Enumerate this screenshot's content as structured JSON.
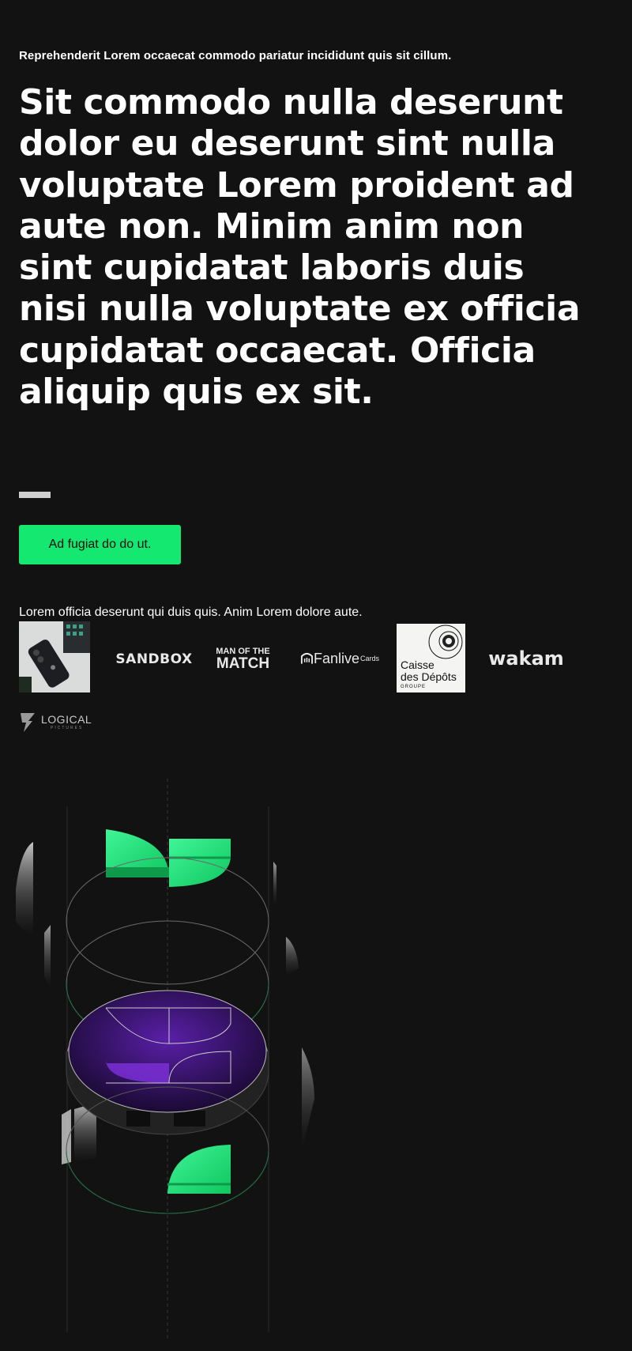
{
  "hero": {
    "eyebrow": "Reprehenderit Lorem occaecat commodo pariatur incididunt quis sit cillum.",
    "headline": "Sit commodo nulla deserunt dolor eu deserunt sint nulla voluptate Lorem proident ad aute non. Minim anim non sint cupidatat laboris duis nisi nulla voluptate ex officia cupidatat occaecat. Officia aliquip quis ex sit.",
    "cta_label": "Ad fugiat do do ut."
  },
  "partners": {
    "label": "Lorem officia deserunt qui duis quis. Anim Lorem dolore aute.",
    "logos": {
      "sandbox": "SANDBOX",
      "motm_top": "MAN OF THE",
      "motm_bottom": "MATCH",
      "fanlive": "Fanlive",
      "fanlive_suffix": "Cards",
      "caisse_line1": "Caisse",
      "caisse_line2": "des Dépôts",
      "caisse_line3": "GROUPE",
      "wakam": "wakam",
      "logical_top": "LOGICAL",
      "logical_bottom": "PICTURES"
    }
  },
  "colors": {
    "background": "#121212",
    "accent_green": "#14e870",
    "accent_purple": "#7b2fd6"
  }
}
